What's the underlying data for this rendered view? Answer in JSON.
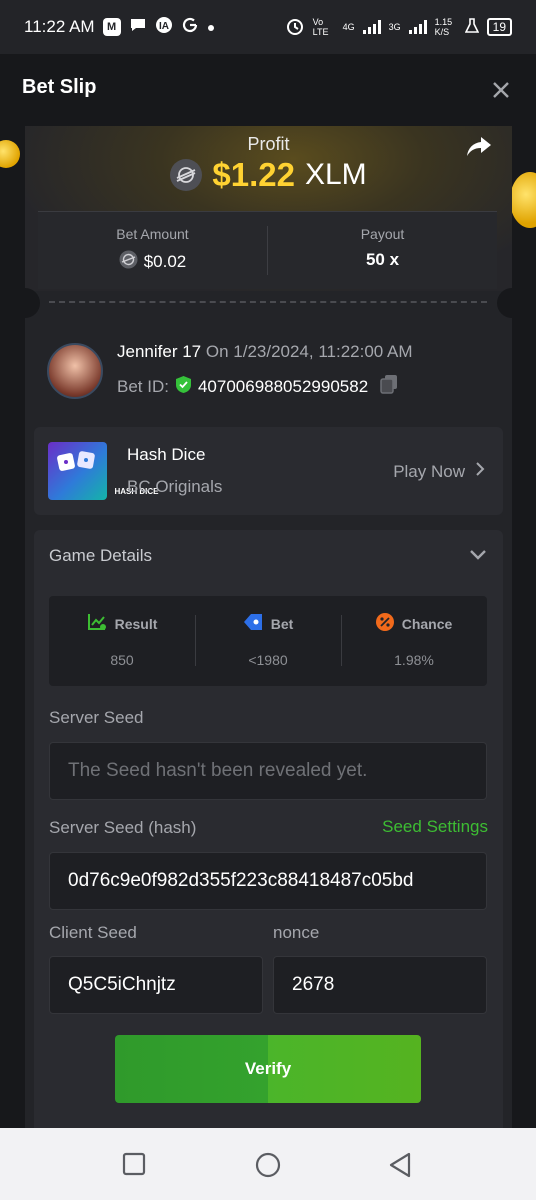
{
  "status_bar": {
    "time": "11:22 AM",
    "network_left": "Vo LTE",
    "network_4g": "4G",
    "network_3g": "3G",
    "speed": "1.15 K/S",
    "battery": "19"
  },
  "header": {
    "title": "Bet Slip",
    "close_label": "✕"
  },
  "profit": {
    "label": "Profit",
    "amount": "$1.22",
    "currency": "XLM"
  },
  "stats": {
    "bet_amount_label": "Bet Amount",
    "bet_amount_value": "$0.02",
    "payout_label": "Payout",
    "payout_value": "50 x"
  },
  "user": {
    "name": "Jennifer 17",
    "date": "On 1/23/2024, 11:22:00 AM",
    "bet_id_label": "Bet ID:",
    "bet_id": "407006988052990582"
  },
  "game": {
    "thumb_label": "HASH DICE",
    "name": "Hash Dice",
    "provider": "BC Originals",
    "play_label": "Play Now"
  },
  "details": {
    "title": "Game Details",
    "result_label": "Result",
    "result_value": "850",
    "bet_label": "Bet",
    "bet_value": "<1980",
    "chance_label": "Chance",
    "chance_value": "1.98%",
    "server_seed_label": "Server Seed",
    "server_seed_placeholder": "The Seed hasn't been revealed yet.",
    "server_hash_label": "Server Seed (hash)",
    "seed_settings_label": "Seed Settings",
    "server_hash_value": "0d76c9e0f982d355f223c88418487c05bd",
    "client_seed_label": "Client Seed",
    "client_seed_value": "Q5C5iChnjtz",
    "nonce_label": "nonce",
    "nonce_value": "2678",
    "verify_label": "Verify"
  },
  "colors": {
    "accent_green": "#3dbd33",
    "profit_gold": "#ffd232",
    "background": "#17181b",
    "card": "#232428"
  }
}
